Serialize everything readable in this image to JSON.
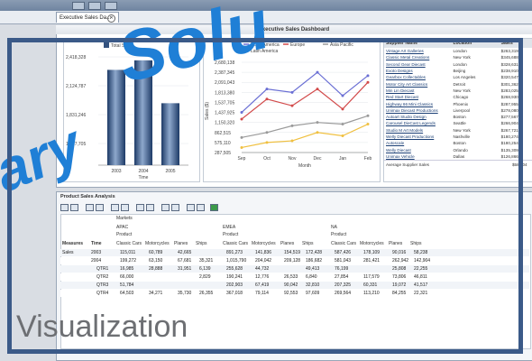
{
  "tab": {
    "label": "Executive Sales Da..."
  },
  "dashboard": {
    "title": "Executive Sales Dashboard"
  },
  "bar_chart": {
    "legend": "Total Sales",
    "categories": [
      "2003",
      "2004",
      "2005"
    ],
    "xlabel": "Time",
    "yticks": [
      "2,418,328",
      "2,124,787",
      "1,831,246",
      "1,537,705"
    ]
  },
  "line_chart": {
    "legend": [
      "North America",
      "Europe",
      "Asia Pacific",
      "Latin America"
    ],
    "legend_colors": [
      "#6a6fd4",
      "#d24a4a",
      "#9a9a9a",
      "#f0c040"
    ],
    "ylabel": "Sales ($)",
    "xlabel": "Month",
    "xticks": [
      "Sep",
      "Oct",
      "Nov",
      "Dec",
      "Jan",
      "Feb"
    ],
    "yticks": [
      "2,680,138",
      "2,387,345",
      "2,091,043",
      "1,813,380",
      "1,537,705",
      "1,437,925",
      "1,150,320",
      "862,515",
      "575,110",
      "287,505"
    ]
  },
  "chart_data": [
    {
      "type": "bar",
      "categories": [
        "2003",
        "2004",
        "2005"
      ],
      "series": [
        {
          "name": "Total Sales",
          "values": [
            2200000,
            2420000,
            1430000
          ]
        }
      ],
      "xlabel": "Time"
    },
    {
      "type": "line",
      "x": [
        "Sep",
        "Oct",
        "Nov",
        "Dec",
        "Jan",
        "Feb"
      ],
      "xlabel": "Month",
      "ylabel": "Sales ($)",
      "series": [
        {
          "name": "North America",
          "values": [
            1200000,
            1900000,
            1800000,
            2400000,
            1700000,
            2300000
          ]
        },
        {
          "name": "Europe",
          "values": [
            1000000,
            1600000,
            1400000,
            1900000,
            1300000,
            2100000
          ]
        },
        {
          "name": "Asia Pacific",
          "values": [
            450000,
            600000,
            800000,
            900000,
            850000,
            1100000
          ]
        },
        {
          "name": "Latin America",
          "values": [
            150000,
            300000,
            350000,
            600000,
            500000,
            850000
          ]
        }
      ]
    }
  ],
  "supplier_table": {
    "headers": [
      "Supplier Name",
      "Location",
      "Sales"
    ],
    "rows": [
      [
        "Vintage Art Galleries",
        "London",
        "$263,319"
      ],
      [
        "Classic Metal Creations",
        "New York",
        "$345,688"
      ],
      [
        "Second Gear Diecast",
        "London",
        "$328,631"
      ],
      [
        "Exoto Designs",
        "Beijing",
        "$238,910"
      ],
      [
        "Gearbox Collectables",
        "Los Angeles",
        "$320,547"
      ],
      [
        "Motor City Art Classics",
        "Detroit",
        "$301,362"
      ],
      [
        "Min Lin Diecast",
        "New York",
        "$283,025"
      ],
      [
        "Red Start Diecast",
        "Chicago",
        "$268,930"
      ],
      [
        "Highway 66 Mini Classics",
        "Phoenix",
        "$287,955"
      ],
      [
        "Unimax Diecast Productions",
        "Liverpool",
        "$278,080"
      ],
      [
        "Autoart Studio Design",
        "Boston",
        "$277,567"
      ],
      [
        "Carousel DieCast Legends",
        "Seattle",
        "$266,904"
      ],
      [
        "Studio M Art Models",
        "New York",
        "$267,721"
      ],
      [
        "Welly Diecast Productions",
        "Nashville",
        "$180,274"
      ],
      [
        "Autoscale",
        "Boston",
        "$180,254"
      ],
      [
        "Welly Diecast",
        "Orlando",
        "$135,309"
      ],
      [
        "Unimax Vehicle",
        "Dallas",
        "$126,866"
      ]
    ],
    "footer": [
      "Average Supplier Sales",
      "$58,904"
    ]
  },
  "analysis": {
    "title": "Product Sales Analysis",
    "markets": "Markets",
    "regions": [
      "APAC",
      "EMEA",
      "NA"
    ],
    "product_lbl": "Product",
    "measures_lbl": "Measures",
    "time_lbl": "Time",
    "product_cols": [
      "Classic Cars",
      "Motorcycles",
      "Planes",
      "Ships"
    ],
    "rows": [
      {
        "measure": "Sales",
        "time": "2003",
        "vals": [
          "115,011",
          "60,789",
          "42,665",
          "",
          "891,273",
          "141,836",
          "154,519",
          "172,428",
          "587,426",
          "178,109",
          "90,016",
          "58,238"
        ]
      },
      {
        "measure": "",
        "time": "2004",
        "vals": [
          "199,272",
          "63,150",
          "67,681",
          "35,321",
          "1,015,790",
          "204,042",
          "209,128",
          "186,682",
          "581,043",
          "281,421",
          "262,942",
          "142,904"
        ]
      },
      {
        "measure": "",
        "time": "QTR1",
        "vals": [
          "16,985",
          "28,888",
          "31,951",
          "6,139",
          "255,628",
          "44,732",
          "",
          "49,413",
          "76,199",
          "",
          "25,808",
          "22,255"
        ]
      },
      {
        "measure": "",
        "time": "QTR2",
        "vals": [
          "66,000",
          "",
          "",
          "2,829",
          "190,241",
          "12,776",
          "26,533",
          "6,840",
          "27,854",
          "117,579",
          "73,806",
          "46,811"
        ]
      },
      {
        "measure": "",
        "time": "QTR3",
        "vals": [
          "51,784",
          "",
          "",
          "",
          "202,903",
          "67,419",
          "90,042",
          "32,810",
          "207,325",
          "60,331",
          "19,072",
          "41,517"
        ]
      },
      {
        "measure": "",
        "time": "QTR4",
        "vals": [
          "64,503",
          "34,271",
          "35,730",
          "26,355",
          "367,018",
          "79,114",
          "92,553",
          "97,609",
          "269,564",
          "113,210",
          "84,255",
          "22,321"
        ]
      }
    ]
  },
  "overlay": {
    "brand_left": "ary",
    "brand_top": "Solu",
    "caption": "Visualization"
  }
}
